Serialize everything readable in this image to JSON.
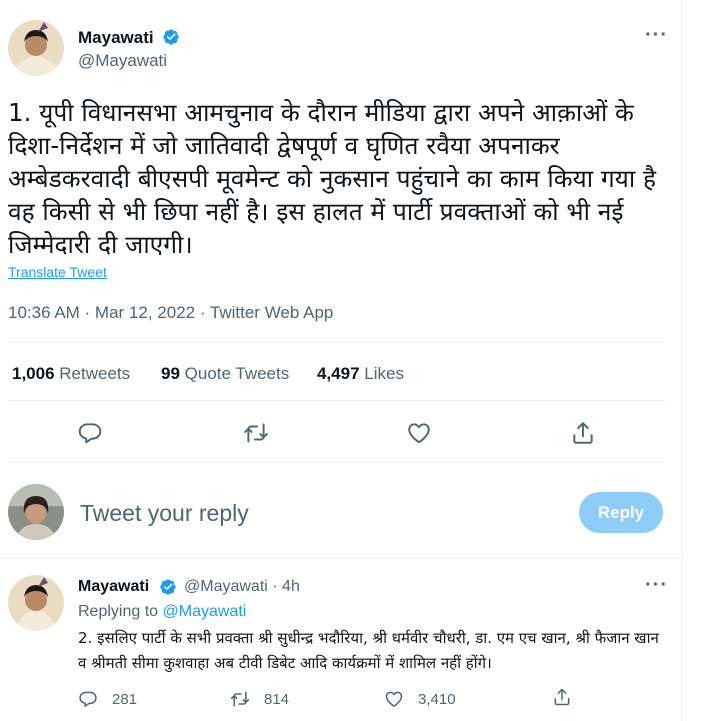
{
  "main_tweet": {
    "author_name": "Mayawati",
    "author_handle": "@Mayawati",
    "text": "1. यूपी विधानसभा आमचुनाव के दौरान मीडिया द्वारा अपने आक़ाओं के दिशा-निर्देशन में जो जातिवादी द्वेषपूर्ण व घृणित रवैया अपनाकर अम्बेडकरवादी बीएसपी मूवमेन्ट को नुकसान पहुंचाने का काम किया गया है वह किसी से भी छिपा नहीं है। इस हालत में पार्टी प्रवक्ताओं को भी नई जिम्मेदारी दी जाएगी।",
    "translate_label": "Translate Tweet",
    "timestamp": "10:36 AM · Mar 12, 2022 · Twitter Web App",
    "retweets_count": "1,006",
    "retweets_label": "Retweets",
    "quote_count": "99",
    "quote_label": "Quote Tweets",
    "likes_count": "4,497",
    "likes_label": "Likes"
  },
  "composer": {
    "placeholder": "Tweet your reply",
    "reply_button_label": "Reply"
  },
  "reply_tweet": {
    "author_name": "Mayawati",
    "author_handle": "@Mayawati",
    "time_ago": "· 4h",
    "replying_to_label": "Replying to",
    "replying_to_handle": "@Mayawati",
    "text": "2. इसलिए पार्टी के सभी प्रवक्ता श्री सुधीन्द्र भदौरिया, श्री धर्मवीर चौधरी, डा. एम एच खान, श्री फैजान खान व श्रीमती सीमा कुशवाहा अब टीवी डिबेट आदि कार्यक्रमों में शामिल नहीं होंगे।",
    "reply_count": "281",
    "retweet_count": "814",
    "like_count": "3,410"
  },
  "icons": {
    "verified": "verified-badge-icon",
    "more": "more-options-icon",
    "reply": "reply-icon",
    "retweet": "retweet-icon",
    "like": "heart-icon",
    "share": "share-icon"
  },
  "colors": {
    "accent": "#1d9bf0",
    "reply_button_disabled": "#8ecdf8",
    "secondary_text": "#536471",
    "primary_text": "#0f1419"
  }
}
